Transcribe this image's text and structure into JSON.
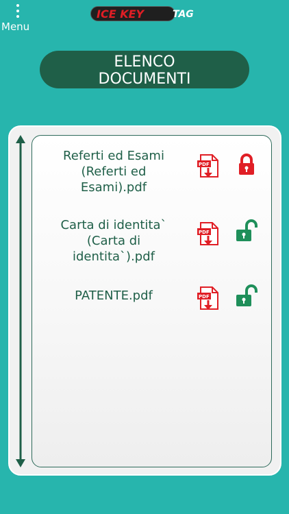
{
  "header": {
    "menu_label": "Menu",
    "logo_main": "ICE KEY",
    "logo_tag": "TAG"
  },
  "title": {
    "text": "ELENCO\nDOCUMENTI"
  },
  "documents": [
    {
      "name": "Referti ed Esami\n(Referti ed\nEsami).pdf",
      "locked": true,
      "lock_color": "#e01e25"
    },
    {
      "name": "Carta di identita`\n(Carta di\nidentita`).pdf",
      "locked": false,
      "lock_color": "#1f8f5a"
    },
    {
      "name": "PATENTE.pdf",
      "locked": false,
      "lock_color": "#1f8f5a"
    }
  ],
  "colors": {
    "background": "#27b5ad",
    "title_bg": "#1f5f48",
    "pdf_red": "#e01e25",
    "text_green": "#1f5f48"
  }
}
